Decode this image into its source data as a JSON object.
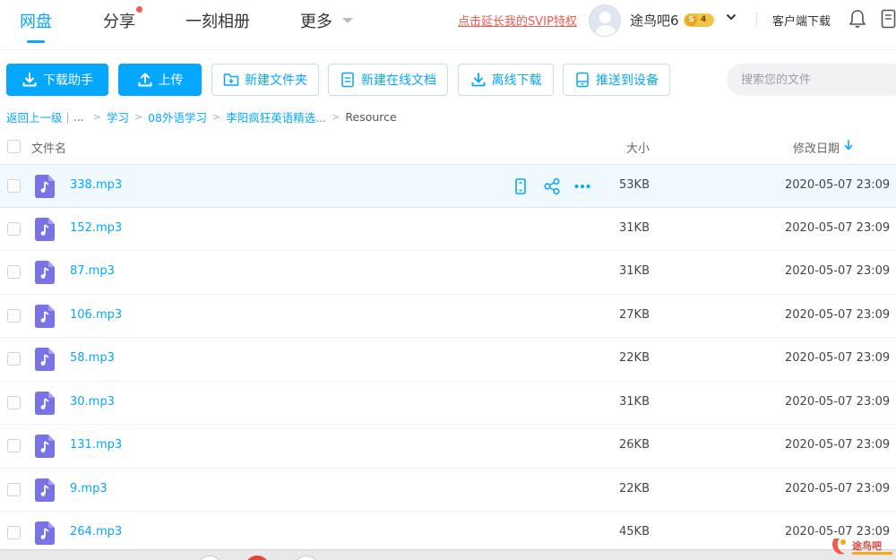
{
  "nav": {
    "tabs": [
      {
        "label": "网盘",
        "active": true
      },
      {
        "label": "分享",
        "active": false,
        "has_dot": true
      },
      {
        "label": "一刻相册",
        "active": false
      },
      {
        "label": "更多",
        "active": false
      }
    ],
    "svip_promo": "点击延长我的SVIP特权",
    "username": "途鸟吧6",
    "vip_letter": "S",
    "vip_level": "4",
    "client_download": "客户端下载",
    "accent_color": "#06a7ff"
  },
  "toolbar": {
    "download_helper": "下载助手",
    "upload": "上传",
    "new_folder": "新建文件夹",
    "new_online_doc": "新建在线文档",
    "offline_download": "离线下载",
    "push_to_device": "推送到设备",
    "search_placeholder": "搜索您的文件"
  },
  "breadcrumb": {
    "back": "返回上一级",
    "ellipsis": "...",
    "items": [
      "学习",
      "08外语学习",
      "李阳疯狂英语精选..."
    ],
    "current": "Resource"
  },
  "table": {
    "columns": {
      "name": "文件名",
      "size": "大小",
      "modified": "修改日期"
    },
    "sort_column": "modified",
    "sort_direction": "desc",
    "rows": [
      {
        "name": "338.mp3",
        "size": "53KB",
        "modified": "2020-05-07 23:09",
        "hovered": true
      },
      {
        "name": "152.mp3",
        "size": "31KB",
        "modified": "2020-05-07 23:09"
      },
      {
        "name": "87.mp3",
        "size": "31KB",
        "modified": "2020-05-07 23:09"
      },
      {
        "name": "106.mp3",
        "size": "27KB",
        "modified": "2020-05-07 23:09"
      },
      {
        "name": "58.mp3",
        "size": "22KB",
        "modified": "2020-05-07 23:09"
      },
      {
        "name": "30.mp3",
        "size": "31KB",
        "modified": "2020-05-07 23:09"
      },
      {
        "name": "131.mp3",
        "size": "26KB",
        "modified": "2020-05-07 23:09"
      },
      {
        "name": "9.mp3",
        "size": "22KB",
        "modified": "2020-05-07 23:09"
      },
      {
        "name": "264.mp3",
        "size": "45KB",
        "modified": "2020-05-07 23:09"
      }
    ]
  },
  "watermark": {
    "text": "途鸟吧"
  }
}
